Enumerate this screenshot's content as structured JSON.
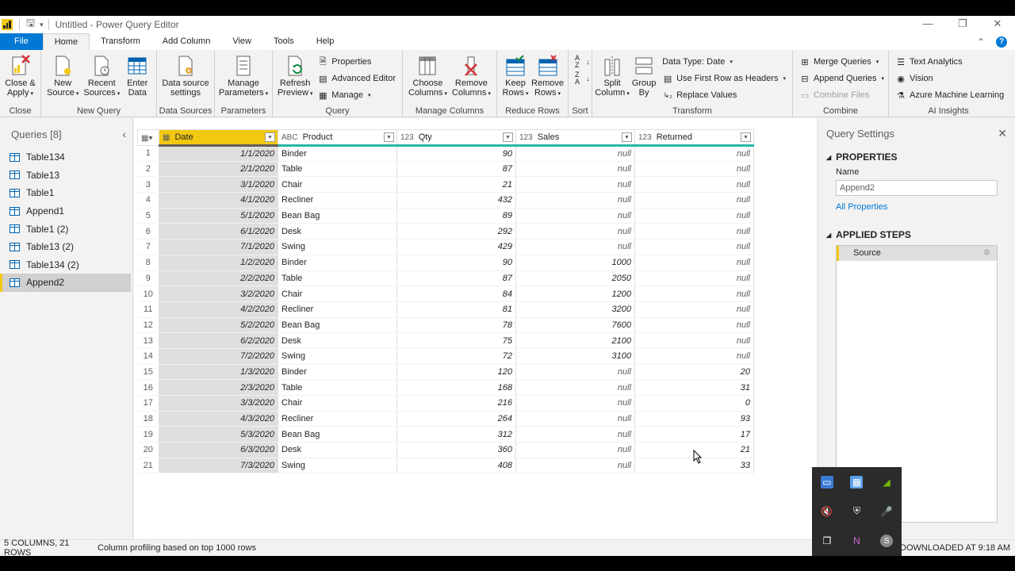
{
  "window": {
    "title": "Untitled - Power Query Editor"
  },
  "menu": {
    "tabs": [
      "File",
      "Home",
      "Transform",
      "Add Column",
      "View",
      "Tools",
      "Help"
    ],
    "active": "Home"
  },
  "ribbon": {
    "close": {
      "close_apply": [
        "Close &",
        "Apply"
      ],
      "label": "Close"
    },
    "new_query": {
      "new_source": [
        "New",
        "Source"
      ],
      "recent_sources": [
        "Recent",
        "Sources"
      ],
      "enter_data": [
        "Enter",
        "Data"
      ],
      "label": "New Query"
    },
    "data_sources": {
      "settings": [
        "Data source",
        "settings"
      ],
      "label": "Data Sources"
    },
    "parameters": {
      "manage": [
        "Manage",
        "Parameters"
      ],
      "label": "Parameters"
    },
    "query": {
      "refresh": [
        "Refresh",
        "Preview"
      ],
      "properties": "Properties",
      "advanced_editor": "Advanced Editor",
      "manage": "Manage",
      "label": "Query"
    },
    "manage_columns": {
      "choose": [
        "Choose",
        "Columns"
      ],
      "remove": [
        "Remove",
        "Columns"
      ],
      "label": "Manage Columns"
    },
    "reduce_rows": {
      "keep": [
        "Keep",
        "Rows"
      ],
      "remove": [
        "Remove",
        "Rows"
      ],
      "label": "Reduce Rows"
    },
    "sort": {
      "label": "Sort"
    },
    "transform": {
      "split": [
        "Split",
        "Column"
      ],
      "group": [
        "Group",
        "By"
      ],
      "data_type": "Data Type: Date",
      "first_row": "Use First Row as Headers",
      "replace": "Replace Values",
      "label": "Transform"
    },
    "combine": {
      "merge": "Merge Queries",
      "append": "Append Queries",
      "combine_files": "Combine Files",
      "label": "Combine"
    },
    "ai": {
      "text": "Text Analytics",
      "vision": "Vision",
      "azure": "Azure Machine Learning",
      "label": "AI Insights"
    }
  },
  "queries": {
    "title": "Queries [8]",
    "items": [
      "Table134",
      "Table13",
      "Table1",
      "Append1",
      "Table1 (2)",
      "Table13 (2)",
      "Table134 (2)",
      "Append2"
    ],
    "selected": "Append2"
  },
  "grid": {
    "columns": [
      {
        "name": "Date",
        "type": ""
      },
      {
        "name": "Product",
        "type": "ABC"
      },
      {
        "name": "Qty",
        "type": "123"
      },
      {
        "name": "Sales",
        "type": "123"
      },
      {
        "name": "Returned",
        "type": "123"
      }
    ],
    "rows": [
      [
        "1/1/2020",
        "Binder",
        "90",
        "null",
        "null"
      ],
      [
        "2/1/2020",
        "Table",
        "87",
        "null",
        "null"
      ],
      [
        "3/1/2020",
        "Chair",
        "21",
        "null",
        "null"
      ],
      [
        "4/1/2020",
        "Recliner",
        "432",
        "null",
        "null"
      ],
      [
        "5/1/2020",
        "Bean Bag",
        "89",
        "null",
        "null"
      ],
      [
        "6/1/2020",
        "Desk",
        "292",
        "null",
        "null"
      ],
      [
        "7/1/2020",
        "Swing",
        "429",
        "null",
        "null"
      ],
      [
        "1/2/2020",
        "Binder",
        "90",
        "1000",
        "null"
      ],
      [
        "2/2/2020",
        "Table",
        "87",
        "2050",
        "null"
      ],
      [
        "3/2/2020",
        "Chair",
        "84",
        "1200",
        "null"
      ],
      [
        "4/2/2020",
        "Recliner",
        "81",
        "3200",
        "null"
      ],
      [
        "5/2/2020",
        "Bean Bag",
        "78",
        "7600",
        "null"
      ],
      [
        "6/2/2020",
        "Desk",
        "75",
        "2100",
        "null"
      ],
      [
        "7/2/2020",
        "Swing",
        "72",
        "3100",
        "null"
      ],
      [
        "1/3/2020",
        "Binder",
        "120",
        "null",
        "20"
      ],
      [
        "2/3/2020",
        "Table",
        "168",
        "null",
        "31"
      ],
      [
        "3/3/2020",
        "Chair",
        "216",
        "null",
        "0"
      ],
      [
        "4/3/2020",
        "Recliner",
        "264",
        "null",
        "93"
      ],
      [
        "5/3/2020",
        "Bean Bag",
        "312",
        "null",
        "17"
      ],
      [
        "6/3/2020",
        "Desk",
        "360",
        "null",
        "21"
      ],
      [
        "7/3/2020",
        "Swing",
        "408",
        "null",
        "33"
      ]
    ]
  },
  "settings": {
    "title": "Query Settings",
    "properties_header": "PROPERTIES",
    "name_label": "Name",
    "name_value": "Append2",
    "all_properties": "All Properties",
    "steps_header": "APPLIED STEPS",
    "steps": [
      "Source"
    ]
  },
  "status": {
    "columns_rows": "5 COLUMNS, 21 ROWS",
    "profiling": "Column profiling based on top 1000 rows",
    "downloaded": "W DOWNLOADED AT 9:18 AM"
  },
  "colors": {
    "accent": "#f2c811",
    "file_tab": "#0078d4",
    "quality_bar": "#2bb7a3"
  }
}
